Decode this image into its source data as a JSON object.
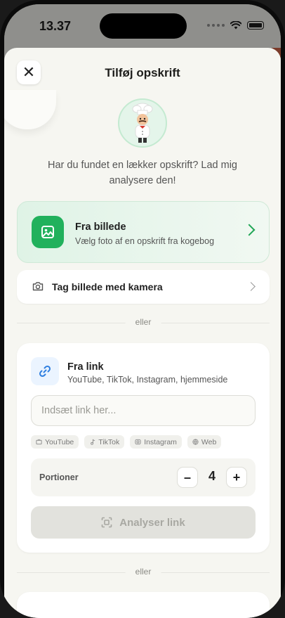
{
  "status": {
    "time": "13.37"
  },
  "sheet": {
    "title": "Tilføj opskrift",
    "close_label": "✕",
    "intro": "Har du fundet en lækker opskrift? Lad mig analysere den!"
  },
  "from_image": {
    "title": "Fra billede",
    "subtitle": "Vælg foto af en opskrift fra kogebog",
    "accent": "#21b15c"
  },
  "camera": {
    "label": "Tag billede med kamera"
  },
  "dividers": {
    "or": "eller"
  },
  "from_link": {
    "title": "Fra link",
    "subtitle": "YouTube, TikTok, Instagram, hjemmeside",
    "placeholder": "Indsæt link her...",
    "chips": [
      "YouTube",
      "TikTok",
      "Instagram",
      "Web"
    ],
    "portions_label": "Portioner",
    "portions_value": "4",
    "minus": "–",
    "plus": "+",
    "analyse_label": "Analyser link"
  }
}
